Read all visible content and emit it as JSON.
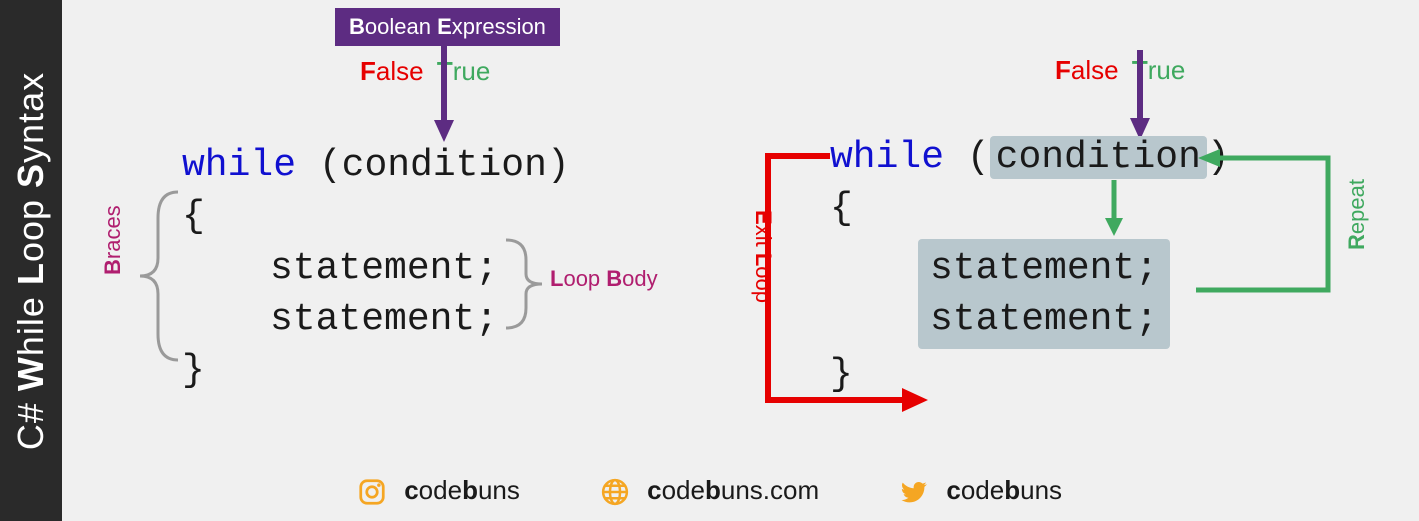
{
  "sidebar": {
    "title_plain": "C# While Loop Syntax",
    "title_html": "C# <b>W</b>hile <b>L</b>oop <b>S</b>yntax"
  },
  "boolean_expression": {
    "label_html": "<b>B</b>oolean <b>E</b>xpression"
  },
  "false_label_html": "<b>F</b>alse",
  "true_label_html": "<b>T</b>rue",
  "left_code": {
    "while_kw": "while",
    "condition": "(condition)",
    "brace_open": "{",
    "stmt1": "statement;",
    "stmt2": "statement;",
    "brace_close": "}"
  },
  "braces_label_html": "<b>B</b>races",
  "loop_body_label_html": "<b>L</b>oop <b>B</b>ody",
  "right_code": {
    "while_kw": "while",
    "condition": "condition",
    "brace_open": "{",
    "stmt1": "statement;",
    "stmt2": "statement;",
    "brace_close": "}"
  },
  "repeat_label_html": "<b>R</b>epeat",
  "exit_label_html": "<b>E</b>xit <b>L</b>oop",
  "footer": {
    "instagram_html": "<b>c</b>ode<b>b</b>uns",
    "web_html": "<b>c</b>ode<b>b</b>uns.com",
    "twitter_html": "<b>c</b>ode<b>b</b>uns"
  },
  "colors": {
    "purple": "#5d2c82",
    "red": "#e60000",
    "green": "#3fa95f",
    "magenta": "#b01e6f",
    "orange": "#f5a623",
    "highlight": "#b8c7cd",
    "keyword": "#1010d0"
  }
}
